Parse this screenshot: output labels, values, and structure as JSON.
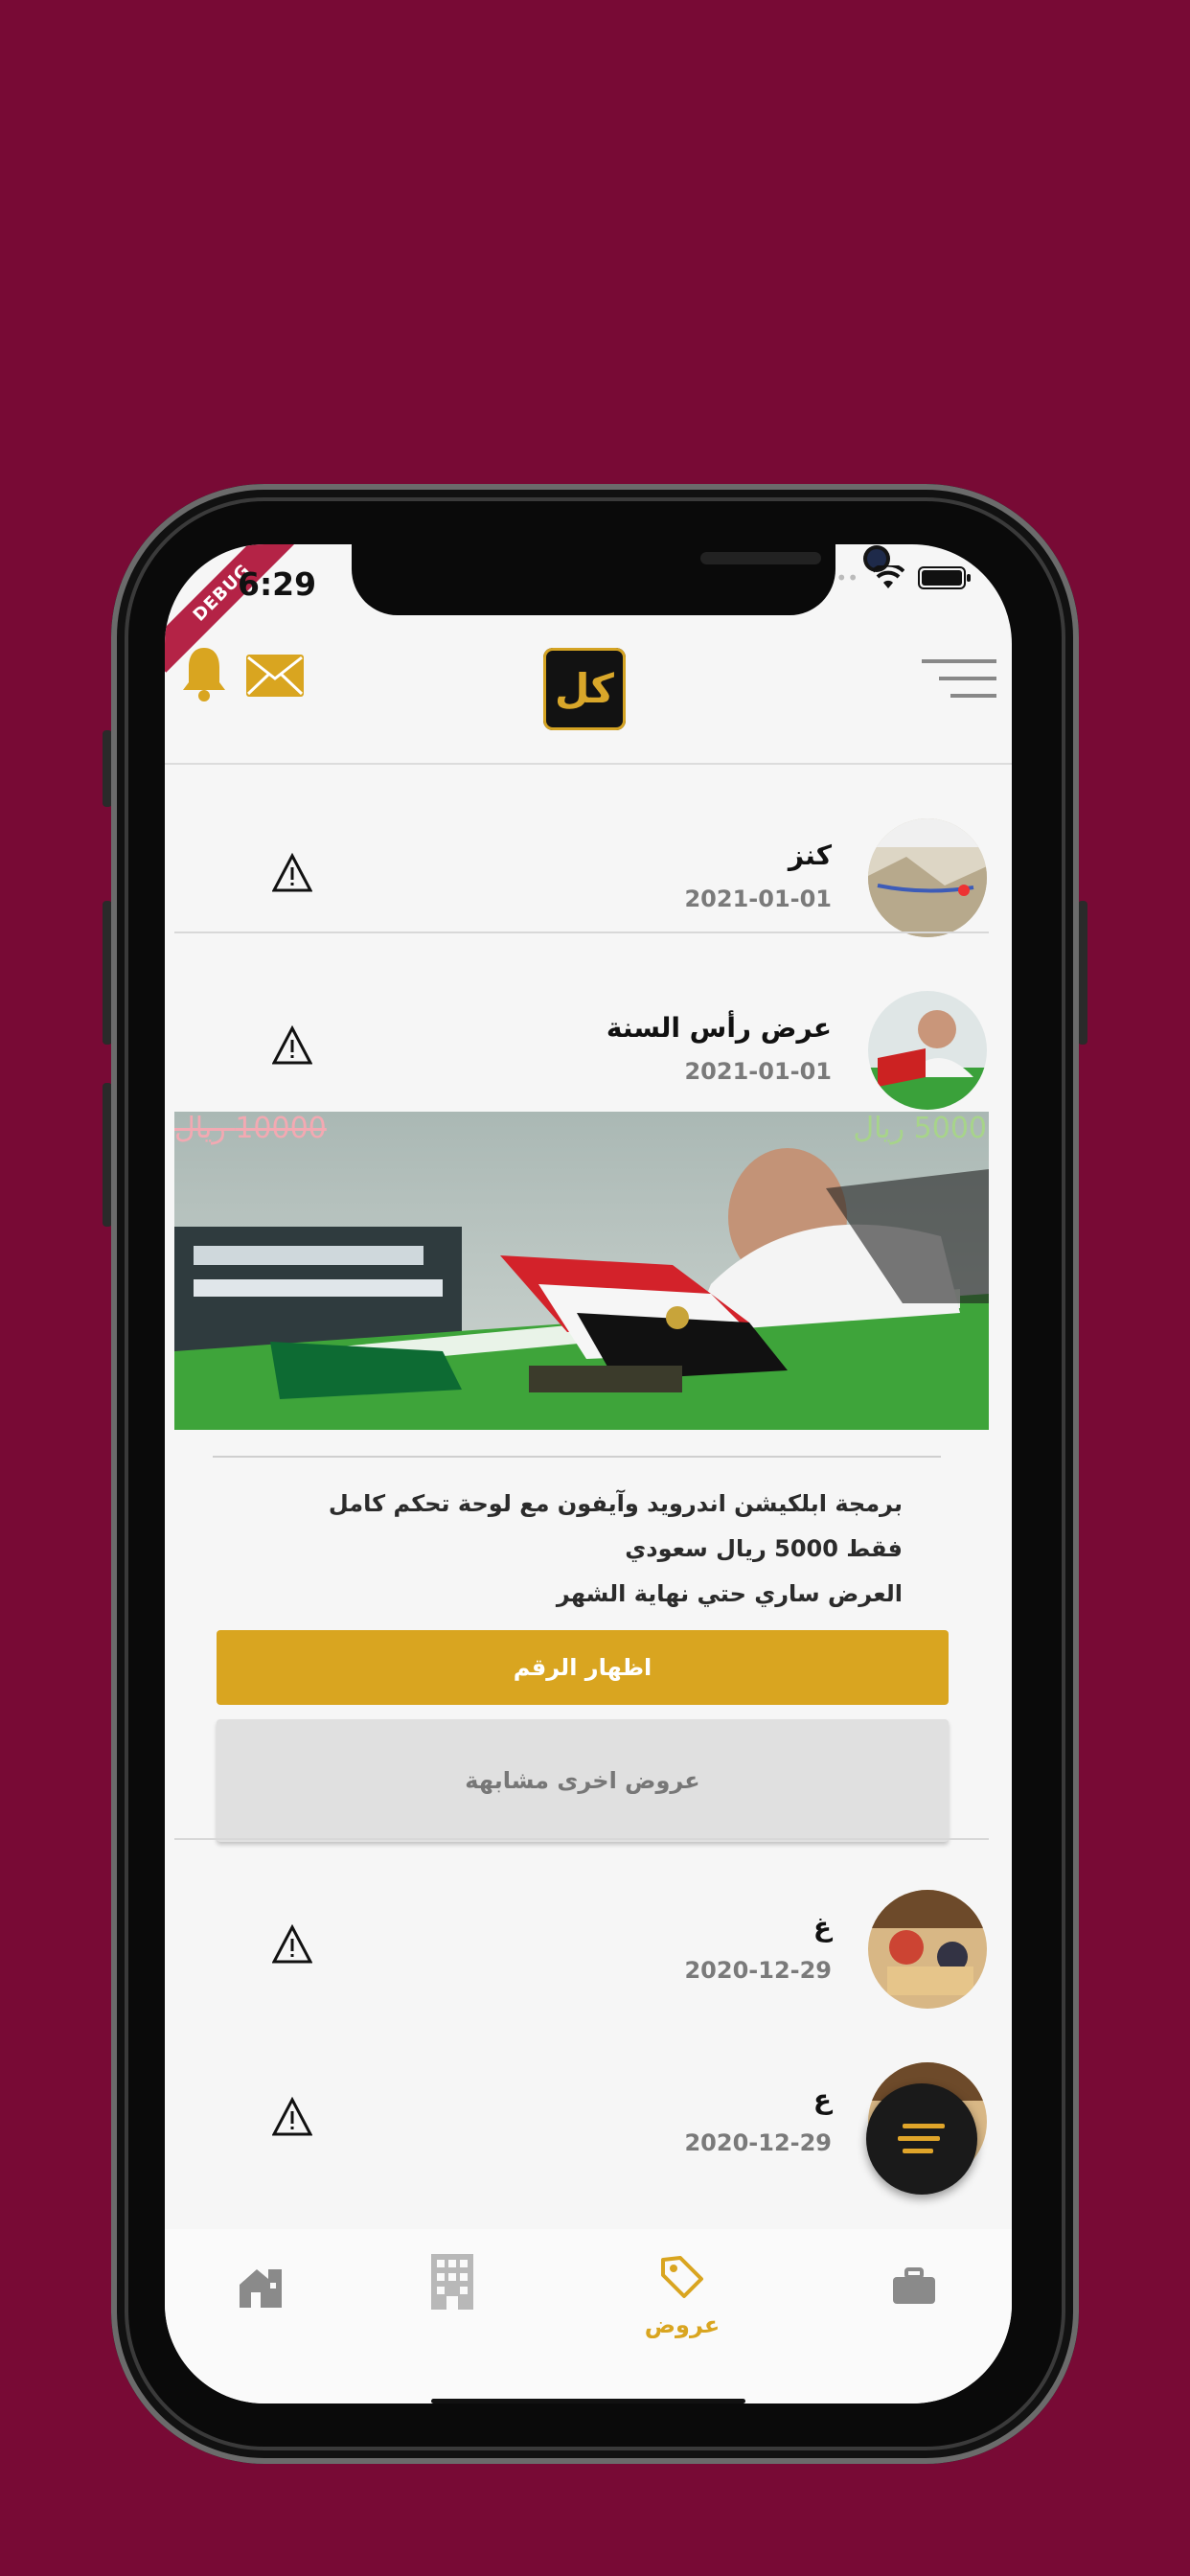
{
  "status": {
    "time": "6:29",
    "debug": "DEBUG"
  },
  "header": {
    "logo_text": "كل",
    "icons": [
      "bell-icon",
      "mail-icon",
      "menu-icon"
    ],
    "accent": "#d9a520"
  },
  "offers": [
    {
      "name": "كنز",
      "date": "2021-01-01"
    },
    {
      "name": "عرض رأس السنة",
      "date": "2021-01-01",
      "price_new": "5000 ريال",
      "price_old": "10000 ريال",
      "description": [
        "برمجة ابلكيشن اندرويد وآيفون مع لوحة تحكم كامل",
        "فقط 5000 ريال سعودي",
        "العرض ساري حتي نهاية الشهر"
      ],
      "show_number_label": "اظهار الرقم",
      "similar_offers_label": "عروض اخرى مشابهة"
    },
    {
      "name": "غ",
      "date": "2020-12-29"
    },
    {
      "name": "ع",
      "date": "2020-12-29"
    }
  ],
  "bottom_nav": {
    "items": [
      {
        "icon": "home-icon",
        "label": ""
      },
      {
        "icon": "building-icon",
        "label": ""
      },
      {
        "icon": "tag-icon",
        "label": "عروض",
        "active": true
      },
      {
        "icon": "briefcase-icon",
        "label": ""
      }
    ]
  }
}
